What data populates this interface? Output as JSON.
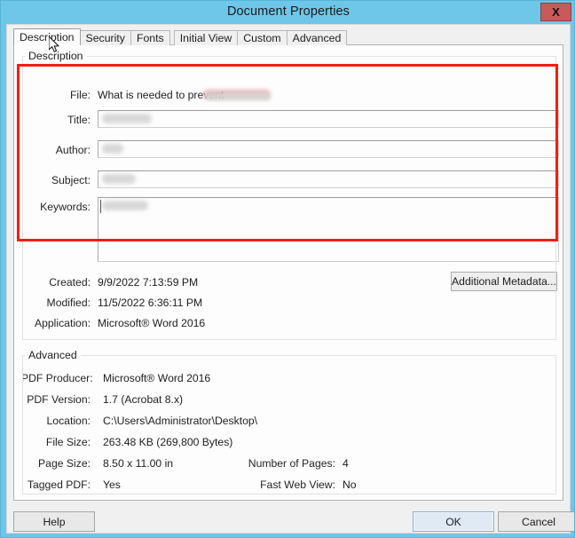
{
  "window": {
    "title": "Document Properties",
    "close_label": "X",
    "accent_color": "#6ec6e8",
    "close_color": "#c75b5b",
    "highlight_color": "#f41d14"
  },
  "tabs": [
    {
      "label": "Description",
      "active": true
    },
    {
      "label": "Security",
      "active": false
    },
    {
      "label": "Fonts",
      "active": false
    },
    {
      "label": "Initial View",
      "active": false
    },
    {
      "label": "Custom",
      "active": false
    },
    {
      "label": "Advanced",
      "active": false
    }
  ],
  "description_group": {
    "legend": "Description",
    "file": {
      "label": "File:",
      "value": "What is needed to prevent",
      "redacted": true
    },
    "title": {
      "label": "Title:",
      "value": "",
      "placeholder": ""
    },
    "author": {
      "label": "Author:",
      "value": "",
      "placeholder": ""
    },
    "subject": {
      "label": "Subject:",
      "value": "",
      "placeholder": ""
    },
    "keywords": {
      "label": "Keywords:",
      "value": "",
      "placeholder": ""
    },
    "created": {
      "label": "Created:",
      "value": "9/9/2022 7:13:59 PM"
    },
    "modified": {
      "label": "Modified:",
      "value": "11/5/2022 6:36:11 PM"
    },
    "application": {
      "label": "Application:",
      "value": "Microsoft® Word 2016"
    },
    "additional_metadata_button": "Additional Metadata..."
  },
  "advanced_group": {
    "legend": "Advanced",
    "pdf_producer": {
      "label": "PDF Producer:",
      "value": "Microsoft® Word 2016"
    },
    "pdf_version": {
      "label": "PDF Version:",
      "value": "1.7 (Acrobat 8.x)"
    },
    "location": {
      "label": "Location:",
      "value": "C:\\Users\\Administrator\\Desktop\\"
    },
    "file_size": {
      "label": "File Size:",
      "value": "263.48 KB (269,800 Bytes)"
    },
    "page_size": {
      "label": "Page Size:",
      "value": "8.50 x 11.00 in"
    },
    "number_of_pages": {
      "label": "Number of Pages:",
      "value": "4"
    },
    "tagged_pdf": {
      "label": "Tagged PDF:",
      "value": "Yes"
    },
    "fast_web_view": {
      "label": "Fast Web View:",
      "value": "No"
    }
  },
  "footer": {
    "help": "Help",
    "ok": "OK",
    "cancel": "Cancel"
  }
}
